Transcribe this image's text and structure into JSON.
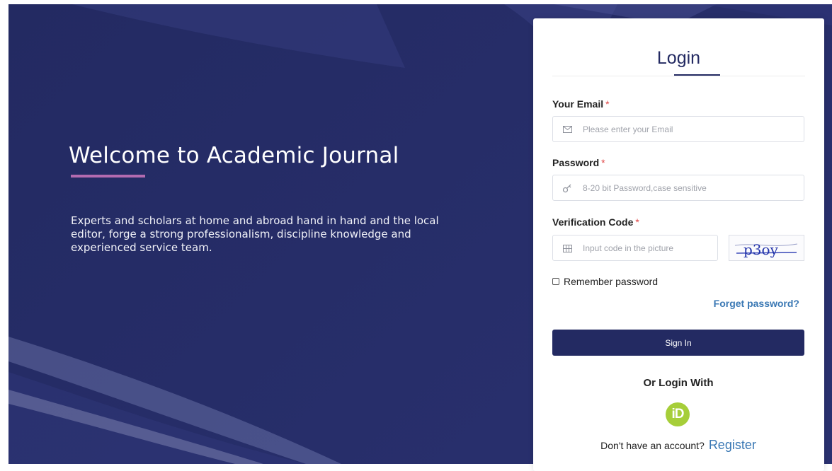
{
  "hero": {
    "title": "Welcome to Academic Journal",
    "description": "Experts and scholars at home and abroad hand in hand and the local editor, forge a strong professionalism, discipline knowledge and experienced service team."
  },
  "login": {
    "title": "Login",
    "email": {
      "label": "Your Email",
      "required": "*",
      "placeholder": "Please enter your Email",
      "icon": "envelope-icon"
    },
    "password": {
      "label": "Password",
      "required": "*",
      "placeholder": "8-20 bit Password,case sensitive",
      "icon": "key-icon"
    },
    "verification": {
      "label": "Verification Code",
      "required": "*",
      "placeholder": "Input code in the picture",
      "icon": "grid-icon",
      "captcha_text": "p3oy"
    },
    "remember_label": "Remember password",
    "forget_label": "Forget password?",
    "signin_label": "Sign In",
    "or_login_label": "Or Login With",
    "orcid_label": "iD",
    "no_account_label": "Don't have an account?",
    "register_label": "Register"
  },
  "colors": {
    "hero_bg": "#232a62",
    "accent_underline": "#b36bb0",
    "primary": "#232a62",
    "link": "#3a78b4",
    "orcid": "#a6ce39",
    "required": "#e04646"
  }
}
